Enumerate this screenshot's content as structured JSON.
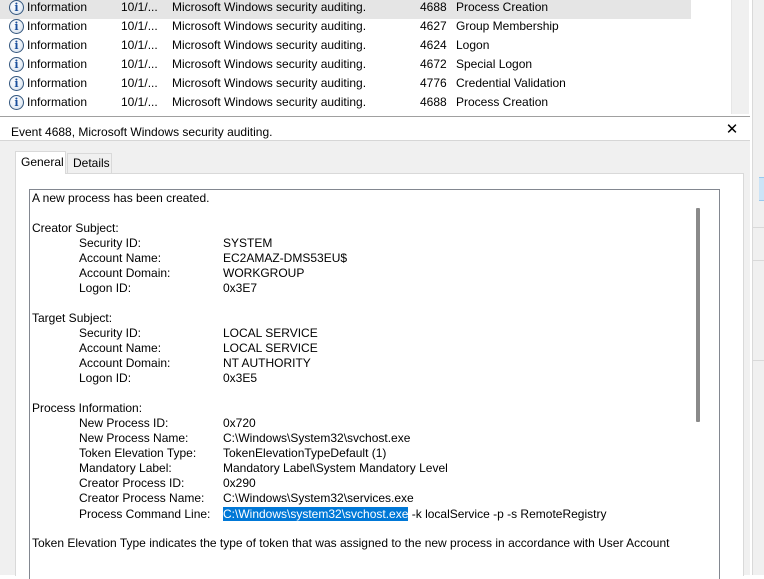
{
  "event_list": {
    "rows": [
      {
        "level": "Information",
        "date": "10/1/...",
        "source": "Microsoft Windows security auditing.",
        "event_id": "4688",
        "task": "Process Creation",
        "selected": true
      },
      {
        "level": "Information",
        "date": "10/1/...",
        "source": "Microsoft Windows security auditing.",
        "event_id": "4627",
        "task": "Group Membership",
        "selected": false
      },
      {
        "level": "Information",
        "date": "10/1/...",
        "source": "Microsoft Windows security auditing.",
        "event_id": "4624",
        "task": "Logon",
        "selected": false
      },
      {
        "level": "Information",
        "date": "10/1/...",
        "source": "Microsoft Windows security auditing.",
        "event_id": "4672",
        "task": "Special Logon",
        "selected": false
      },
      {
        "level": "Information",
        "date": "10/1/...",
        "source": "Microsoft Windows security auditing.",
        "event_id": "4776",
        "task": "Credential Validation",
        "selected": false
      },
      {
        "level": "Information",
        "date": "10/1/...",
        "source": "Microsoft Windows security auditing.",
        "event_id": "4688",
        "task": "Process Creation",
        "selected": false
      }
    ],
    "level_icon": "information-icon",
    "icon_glyph": "i"
  },
  "detail": {
    "title": "Event 4688, Microsoft Windows security auditing.",
    "close_glyph": "✕",
    "tabs": [
      {
        "label": "General",
        "active": true
      },
      {
        "label": "Details",
        "active": false
      }
    ],
    "message": {
      "intro": "A new process has been created.",
      "creator_subject": {
        "heading": "Creator Subject:",
        "fields": [
          {
            "label": "Security ID:",
            "value": "SYSTEM"
          },
          {
            "label": "Account Name:",
            "value": "EC2AMAZ-DMS53EU$"
          },
          {
            "label": "Account Domain:",
            "value": "WORKGROUP"
          },
          {
            "label": "Logon ID:",
            "value": "0x3E7"
          }
        ]
      },
      "target_subject": {
        "heading": "Target Subject:",
        "fields": [
          {
            "label": "Security ID:",
            "value": "LOCAL SERVICE"
          },
          {
            "label": "Account Name:",
            "value": "LOCAL SERVICE"
          },
          {
            "label": "Account Domain:",
            "value": "NT AUTHORITY"
          },
          {
            "label": "Logon ID:",
            "value": "0x3E5"
          }
        ]
      },
      "process_information": {
        "heading": "Process Information:",
        "fields": [
          {
            "label": "New Process ID:",
            "value": "0x720"
          },
          {
            "label": "New Process Name:",
            "value": "C:\\Windows\\System32\\svchost.exe"
          },
          {
            "label": "Token Elevation Type:",
            "value": "TokenElevationTypeDefault (1)"
          },
          {
            "label": "Mandatory Label:",
            "value": "Mandatory Label\\System Mandatory Level"
          },
          {
            "label": "Creator Process ID:",
            "value": "0x290"
          },
          {
            "label": "Creator Process Name:",
            "value": "C:\\Windows\\System32\\services.exe"
          }
        ],
        "command_line": {
          "label": "Process Command Line:",
          "selected_text": "C:\\Windows\\system32\\svchost.exe",
          "rest_text": " -k localService -p -s RemoteRegistry"
        }
      },
      "footer": "Token Elevation Type indicates the type of token that was assigned to the new process in accordance with User Account"
    }
  },
  "colors": {
    "selection_row": "#e5e5e5",
    "text_selection": "#0078d7",
    "pane_background": "#f0f0f0"
  }
}
